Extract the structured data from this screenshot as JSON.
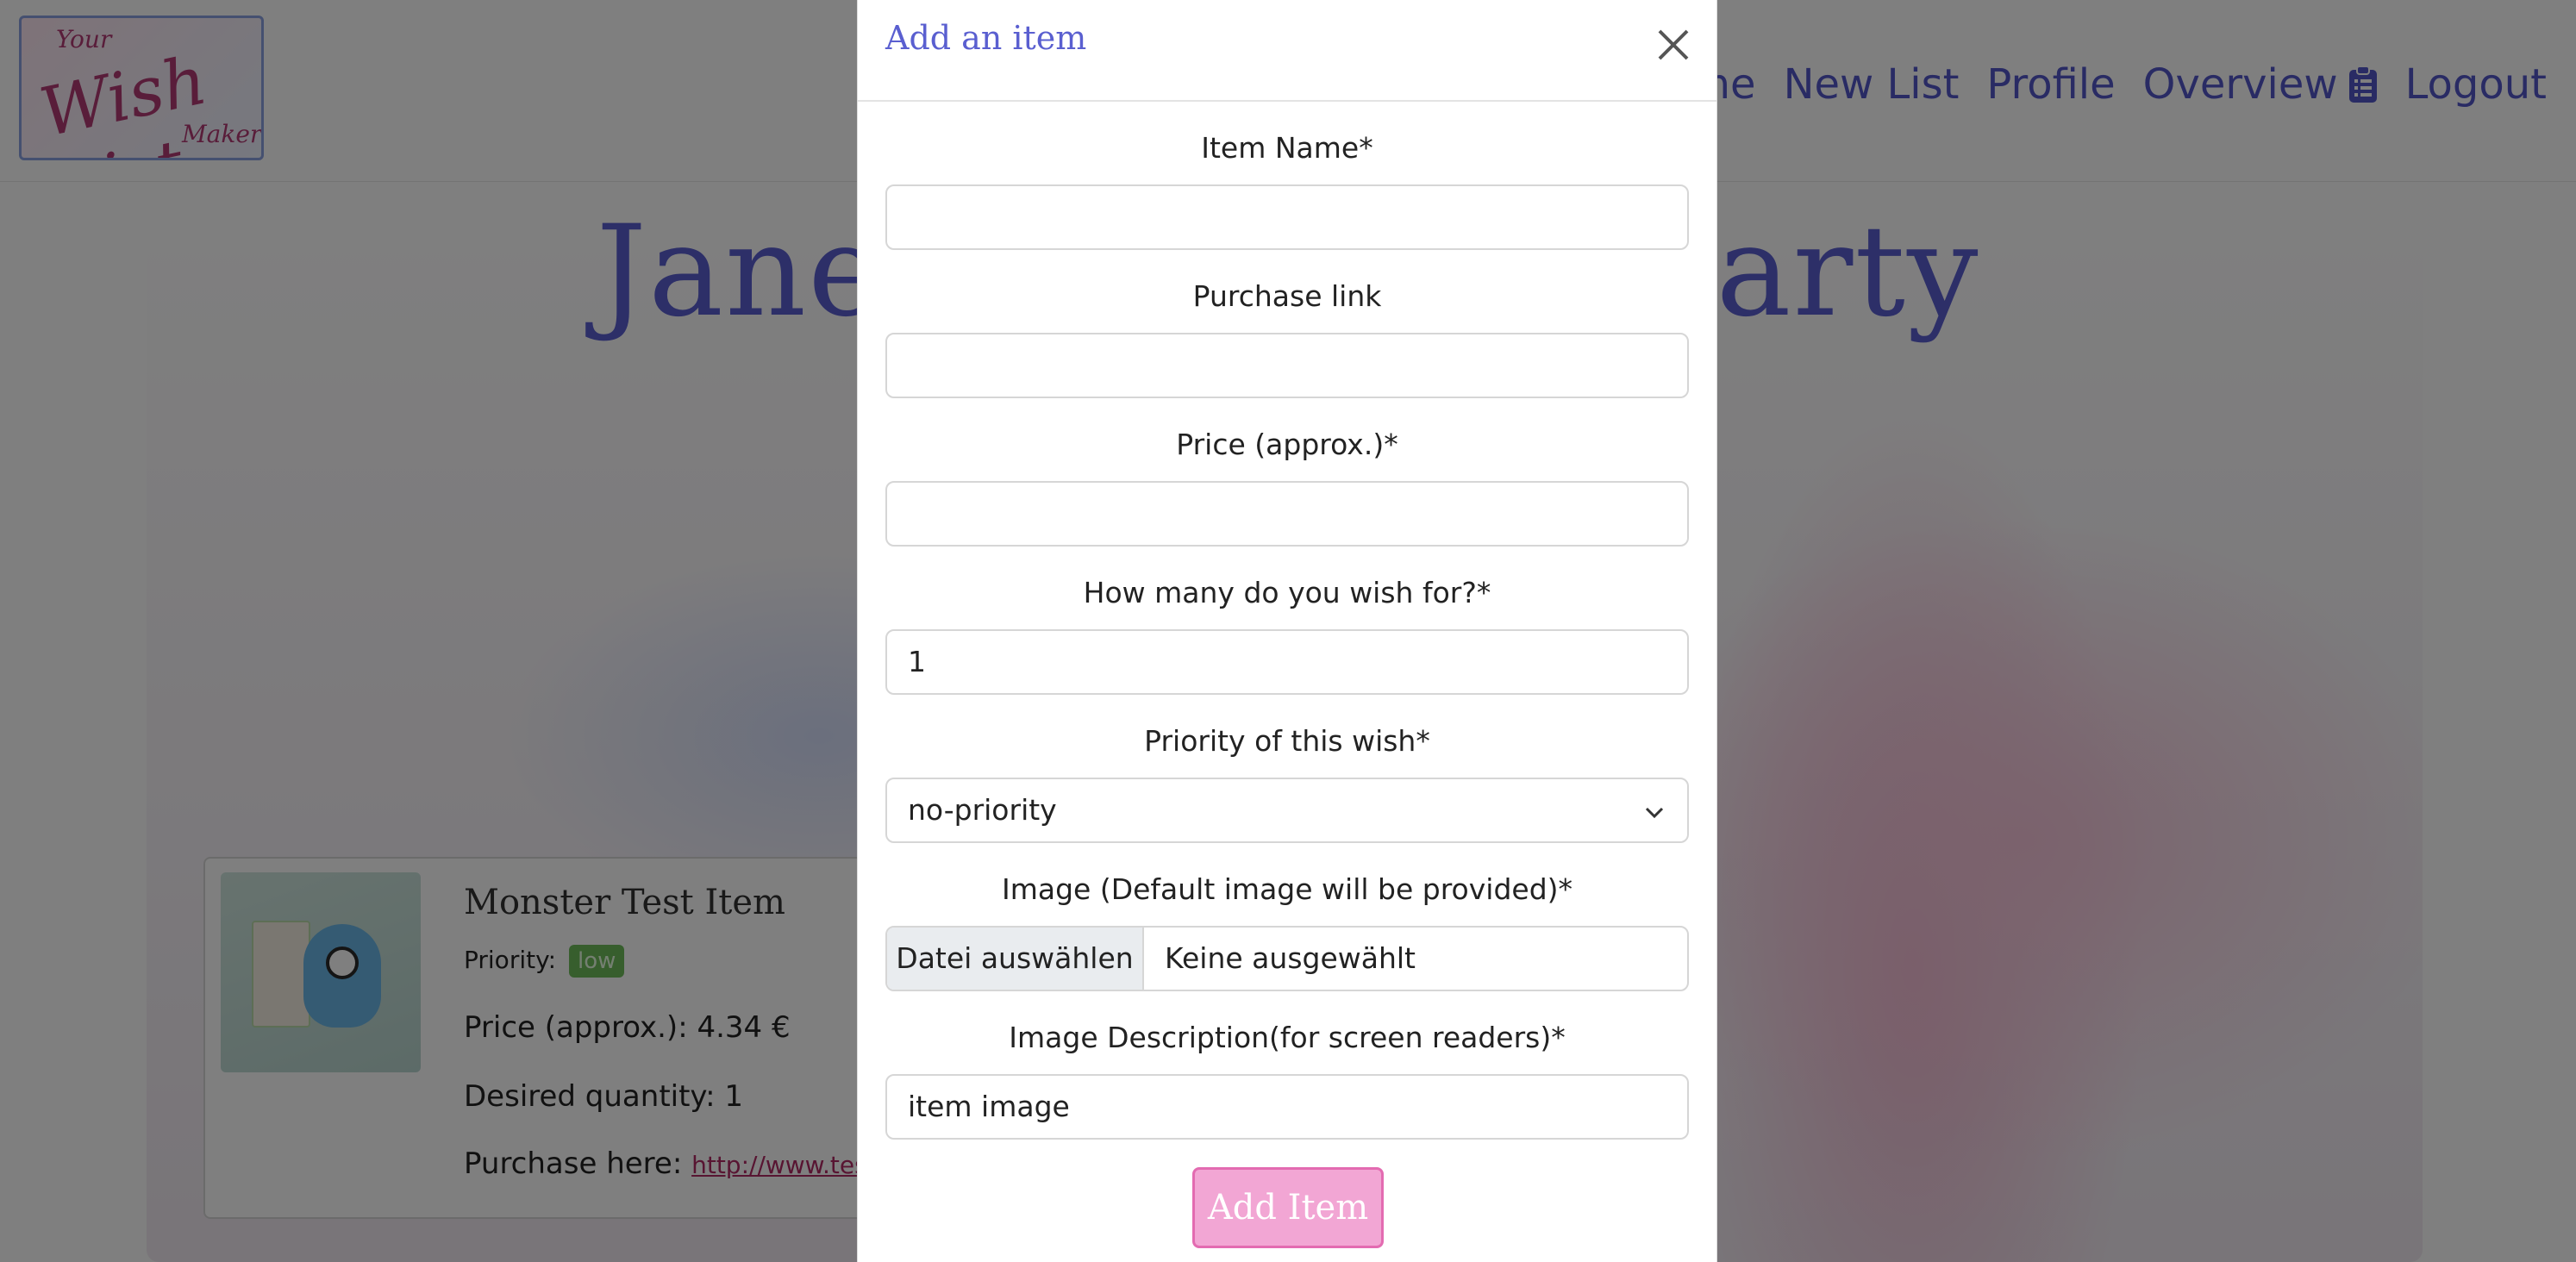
{
  "navbar": {
    "logo_alt": "Your Wish List Maker",
    "links": [
      {
        "label": "Home"
      },
      {
        "label": "New List"
      },
      {
        "label": "Profile"
      },
      {
        "label": "Overview"
      },
      {
        "label": "Logout"
      }
    ],
    "overview_icon": "clipboard-list-icon"
  },
  "page": {
    "list_title": "Jane's Birthday Party",
    "item": {
      "name": "Monster Test Item",
      "priority_label": "Priority:",
      "priority_value": "low",
      "price": "Price (approx.): 4.34 €",
      "quantity": "Desired quantity: 1",
      "purchase_label": "Purchase here:",
      "purchase_link": "http://www.test.de"
    }
  },
  "modal": {
    "title": "Add an item",
    "close_icon": "close-icon",
    "fields": {
      "item_name": {
        "label": "Item Name*",
        "value": ""
      },
      "purchase_link": {
        "label": "Purchase link",
        "value": ""
      },
      "price": {
        "label": "Price (approx.)*",
        "value": ""
      },
      "quantity": {
        "label": "How many do you wish for?*",
        "value": "1"
      },
      "priority": {
        "label": "Priority of this wish*",
        "value": "no-priority"
      },
      "image": {
        "label": "Image (Default image will be provided)*",
        "button": "Datei auswählen",
        "status": "Keine ausgewählt"
      },
      "image_description": {
        "label": "Image Description(for screen readers)*",
        "value": "item image"
      }
    },
    "submit_label": "Add Item"
  },
  "colors": {
    "accent": "#5a5fd0",
    "brand_pink": "#e36bb1",
    "button_fill": "#f2a6d4",
    "badge_low": "#6fbd5a"
  }
}
